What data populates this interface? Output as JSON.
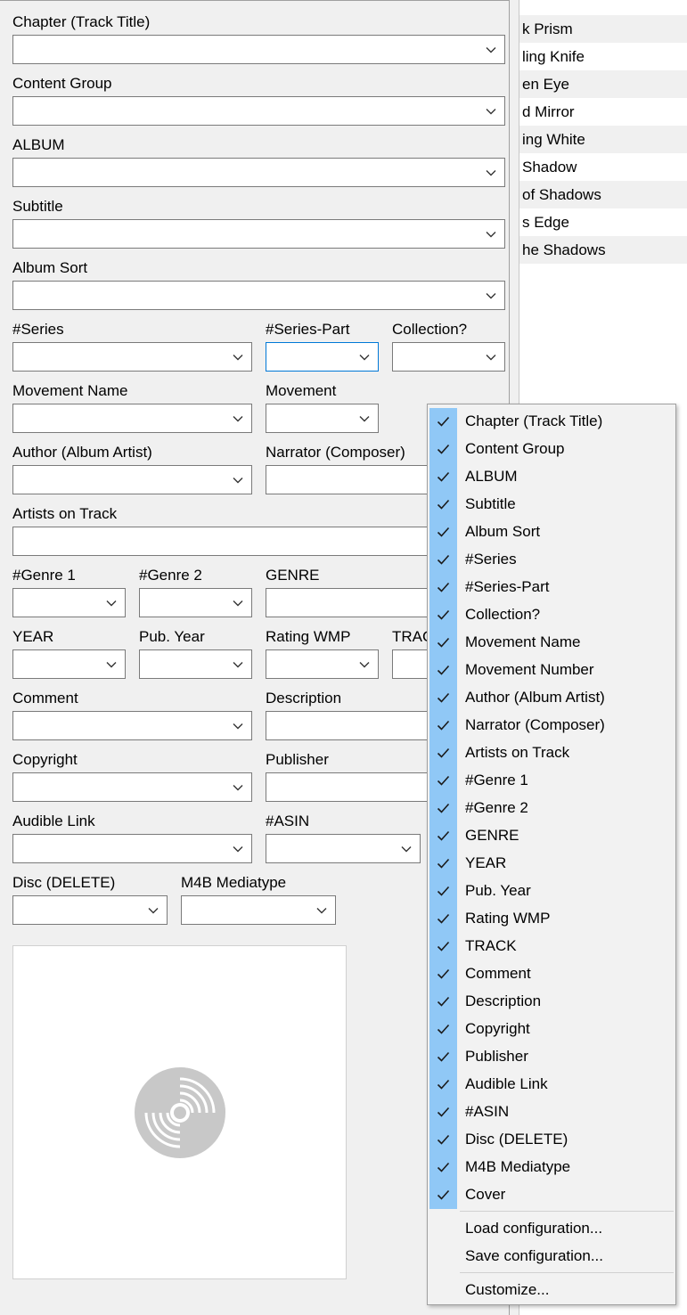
{
  "background_list": {
    "rows": [
      "k Prism",
      "ling Knife",
      "en Eye",
      "d Mirror",
      "ing White",
      "Shadow",
      "of Shadows",
      "s Edge",
      "he Shadows"
    ]
  },
  "form": {
    "labels": {
      "chapter": "Chapter (Track Title)",
      "content_group": "Content Group",
      "album": "ALBUM",
      "subtitle": "Subtitle",
      "album_sort": "Album Sort",
      "series": "#Series",
      "series_part": "#Series-Part",
      "collection": "Collection?",
      "movement_name": "Movement Name",
      "movement": "Movement",
      "author": "Author (Album Artist)",
      "narrator": "Narrator (Composer)",
      "artists_on_track": "Artists on Track",
      "genre1": "#Genre 1",
      "genre2": "#Genre 2",
      "genre": "GENRE",
      "year": "YEAR",
      "pub_year": "Pub. Year",
      "rating_wmp": "Rating WMP",
      "track": "TRAC",
      "comment": "Comment",
      "description": "Description",
      "copyright": "Copyright",
      "publisher": "Publisher",
      "audible_link": "Audible Link",
      "asin": "#ASIN",
      "disc": "Disc (DELETE)",
      "m4b_mediatype": "M4B Mediatype"
    }
  },
  "context_menu": {
    "checked_items": [
      "Chapter (Track Title)",
      "Content Group",
      "ALBUM",
      "Subtitle",
      "Album Sort",
      "#Series",
      "#Series-Part",
      "Collection?",
      "Movement Name",
      "Movement Number",
      "Author (Album Artist)",
      "Narrator (Composer)",
      "Artists on Track",
      "#Genre 1",
      "#Genre 2",
      "GENRE",
      "YEAR",
      "Pub. Year",
      "Rating WMP",
      "TRACK",
      "Comment",
      "Description",
      "Copyright",
      "Publisher",
      "Audible Link",
      "#ASIN",
      "Disc (DELETE)",
      "M4B Mediatype",
      "Cover"
    ],
    "load_configuration": "Load configuration...",
    "save_configuration": "Save configuration...",
    "customize": "Customize..."
  },
  "colors": {
    "check_highlight": "#90c8f6",
    "focus_border": "#0078d7"
  },
  "icons": {
    "dropdown": "chevron-down-icon",
    "check": "checkmark-icon",
    "cover_placeholder": "disc-icon"
  }
}
